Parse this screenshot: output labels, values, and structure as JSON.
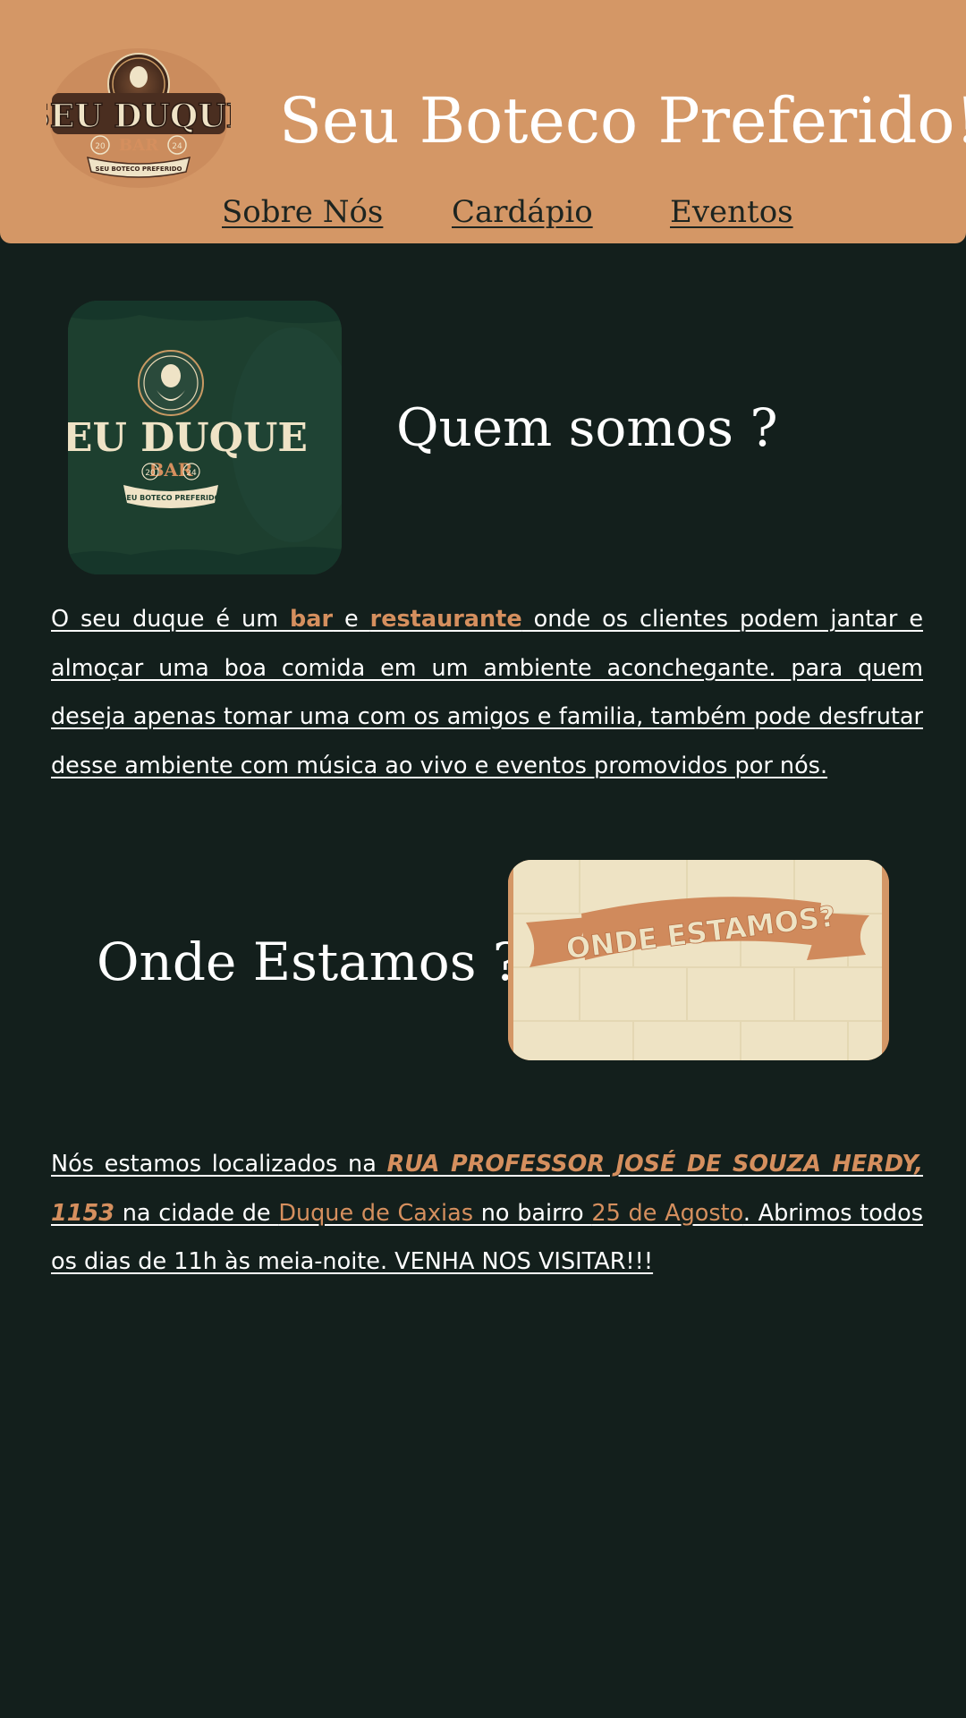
{
  "header": {
    "title": "Seu Boteco Preferido!",
    "logo": {
      "name_line": "SEU DUQUE",
      "sub_line": "BAR",
      "year_left": "20",
      "year_right": "24",
      "ribbon": "SEU BOTECO PREFERIDO"
    },
    "nav": [
      {
        "label": "Sobre Nós"
      },
      {
        "label": "Cardápio"
      },
      {
        "label": "Eventos"
      }
    ]
  },
  "about": {
    "heading": "Quem somos ?",
    "text_1": "O seu duque é um ",
    "bar": "bar",
    "text_2": " e ",
    "restaurante": "restaurante",
    "text_3": " onde os clientes podem jantar e almoçar uma boa comida em um ambiente aconchegante. para quem deseja apenas tomar uma com os amigos e familia, também pode desfrutar desse ambiente com música ao vivo e eventos promovidos por nós."
  },
  "location": {
    "heading": "Onde Estamos ?",
    "banner_text": "ONDE ESTAMOS?",
    "text_1": "Nós estamos localizados na ",
    "address": "RUA PROFESSOR JOSÉ DE SOUZA HERDY, 1153",
    "text_2": " na cidade de ",
    "city": "Duque de Caxias",
    "text_3": " no bairro ",
    "neighborhood": "25 de Agosto",
    "text_4": ". Abrimos todos os dias de 11h às meia-noite. VENHA NOS VISITAR!!!"
  },
  "colors": {
    "header_bg": "#d49766",
    "page_bg": "#131f1c",
    "accent": "#d58f5e",
    "logo_green": "#1d3f2f",
    "banner_cream": "#eee3c4"
  }
}
